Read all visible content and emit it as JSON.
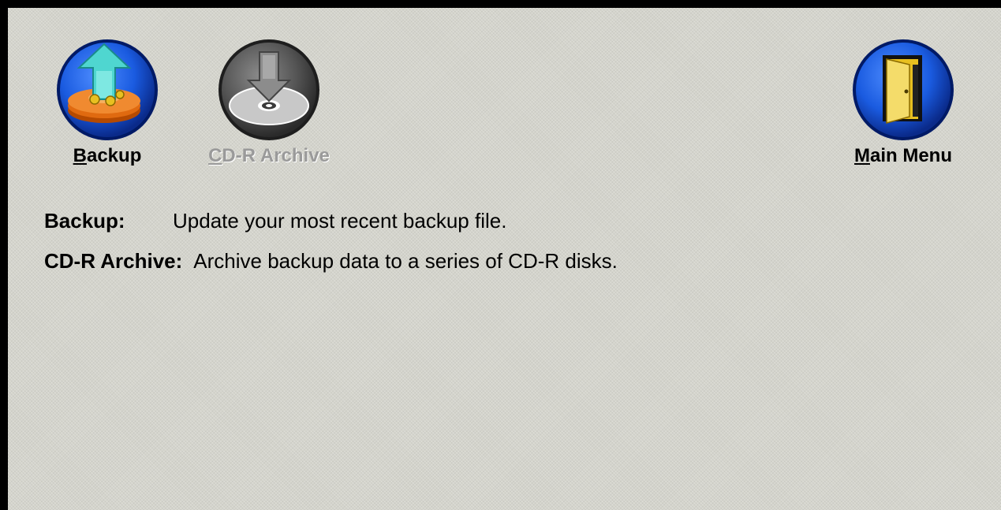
{
  "toolbar": {
    "backup": {
      "hotkey": "B",
      "label_rest": "ackup",
      "icon": "backup-upload-icon",
      "enabled": true
    },
    "cdr_archive": {
      "hotkey": "C",
      "label_rest": "D-R Archive",
      "icon": "cd-archive-icon",
      "enabled": false
    },
    "main_menu": {
      "hotkey": "M",
      "label_rest": "ain Menu",
      "icon": "exit-door-icon",
      "enabled": true
    }
  },
  "descriptions": [
    {
      "term": "Backup:",
      "text": "Update your most recent backup file."
    },
    {
      "term": "CD-R Archive:",
      "text": "Archive backup data to a series of CD-R disks."
    }
  ],
  "colors": {
    "background": "#d4d4cc",
    "frame_border": "#000000",
    "icon_blue": "#1a5be0",
    "disabled_text": "#9a9a9a"
  }
}
